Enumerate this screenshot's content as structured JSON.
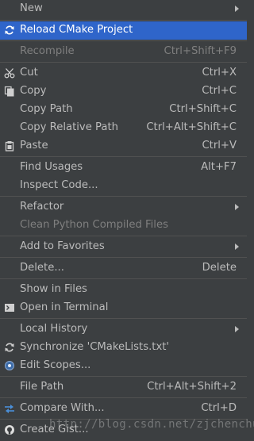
{
  "menu": {
    "items": [
      {
        "label": "New",
        "shortcut": "",
        "arrow": true
      },
      {
        "label": "Reload CMake Project",
        "shortcut": "",
        "icon": "reload-icon"
      },
      {
        "label": "Recompile",
        "shortcut": "Ctrl+Shift+F9"
      },
      {
        "label": "Cut",
        "shortcut": "Ctrl+X",
        "icon": "scissors-icon"
      },
      {
        "label": "Copy",
        "shortcut": "Ctrl+C",
        "icon": "copy-icon"
      },
      {
        "label": "Copy Path",
        "shortcut": "Ctrl+Shift+C"
      },
      {
        "label": "Copy Relative Path",
        "shortcut": "Ctrl+Alt+Shift+C"
      },
      {
        "label": "Paste",
        "shortcut": "Ctrl+V",
        "icon": "clipboard-icon"
      },
      {
        "label": "Find Usages",
        "shortcut": "Alt+F7"
      },
      {
        "label": "Inspect Code...",
        "shortcut": ""
      },
      {
        "label": "Refactor",
        "shortcut": "",
        "arrow": true
      },
      {
        "label": "Clean Python Compiled Files",
        "shortcut": ""
      },
      {
        "label": "Add to Favorites",
        "shortcut": "",
        "arrow": true
      },
      {
        "label": "Delete...",
        "shortcut": "Delete"
      },
      {
        "label": "Show in Files",
        "shortcut": ""
      },
      {
        "label": "Open in Terminal",
        "shortcut": "",
        "icon": "terminal-icon"
      },
      {
        "label": "Local History",
        "shortcut": "",
        "arrow": true
      },
      {
        "label": "Synchronize 'CMakeLists.txt'",
        "shortcut": "",
        "icon": "sync-icon"
      },
      {
        "label": "Edit Scopes...",
        "shortcut": "",
        "icon": "scope-icon"
      },
      {
        "label": "File Path",
        "shortcut": "Ctrl+Alt+Shift+2"
      },
      {
        "label": "Compare With...",
        "shortcut": "Ctrl+D",
        "icon": "compare-icon"
      },
      {
        "label": "Create Gist...",
        "shortcut": "",
        "icon": "github-icon"
      }
    ]
  },
  "watermark": "http://blog.csdn.net/zjchenchujie",
  "colors": {
    "background": "#3c3f41",
    "selection": "#2f65ca",
    "text": "#bbbbbb",
    "disabled_text": "#7f7f7f",
    "separator": "#515151"
  }
}
